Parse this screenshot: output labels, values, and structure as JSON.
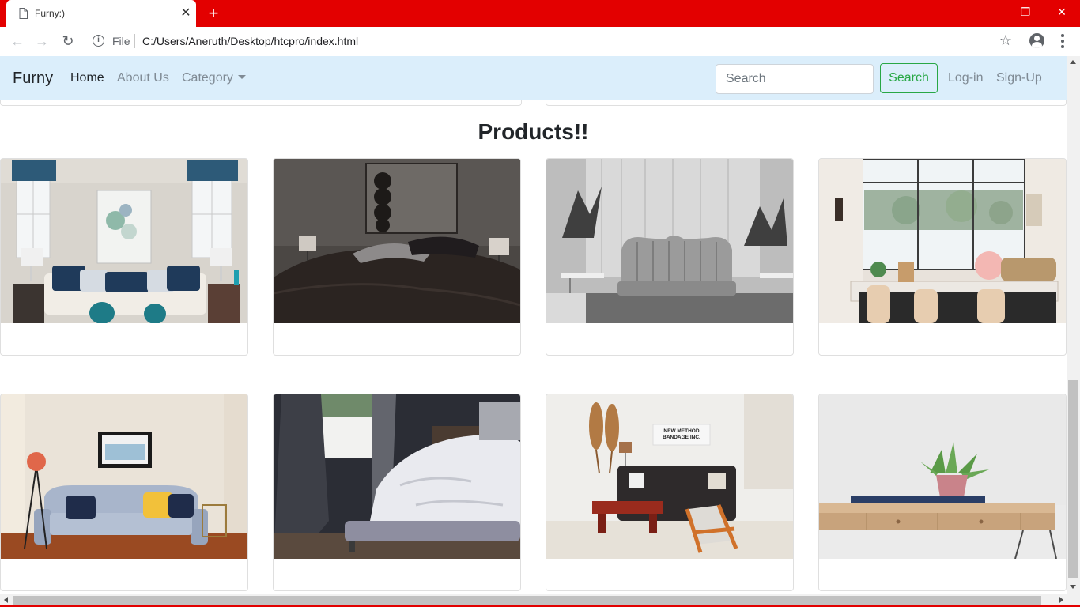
{
  "browser": {
    "tab_title": "Furny:)",
    "new_tab_icon": "plus-icon",
    "file_label": "File",
    "url": "C:/Users/Aneruth/Desktop/htcpro/index.html",
    "accent_color": "#e30000"
  },
  "navbar": {
    "brand": "Furny",
    "links": [
      "Home",
      "About Us",
      "Category"
    ],
    "active_link": "Home",
    "search_placeholder": "Search",
    "search_button": "Search",
    "login": "Log-in",
    "signup": "Sign-Up",
    "background_color": "#dbeefb"
  },
  "main": {
    "heading": "Products!!",
    "products": [
      {
        "image": "living-room-white-sofa-blue-pillows"
      },
      {
        "image": "dark-bedroom-with-lamps"
      },
      {
        "image": "grayscale-channel-tufted-sofa"
      },
      {
        "image": "bright-dining-room-large-windows"
      },
      {
        "image": "light-blue-sofa-with-yellow-pillow"
      },
      {
        "image": "bed-with-white-sheets-dark-room"
      },
      {
        "image": "living-room-with-snowshoes-and-new-method-bandage-sign"
      },
      {
        "image": "wooden-console-table-with-plant"
      }
    ]
  }
}
